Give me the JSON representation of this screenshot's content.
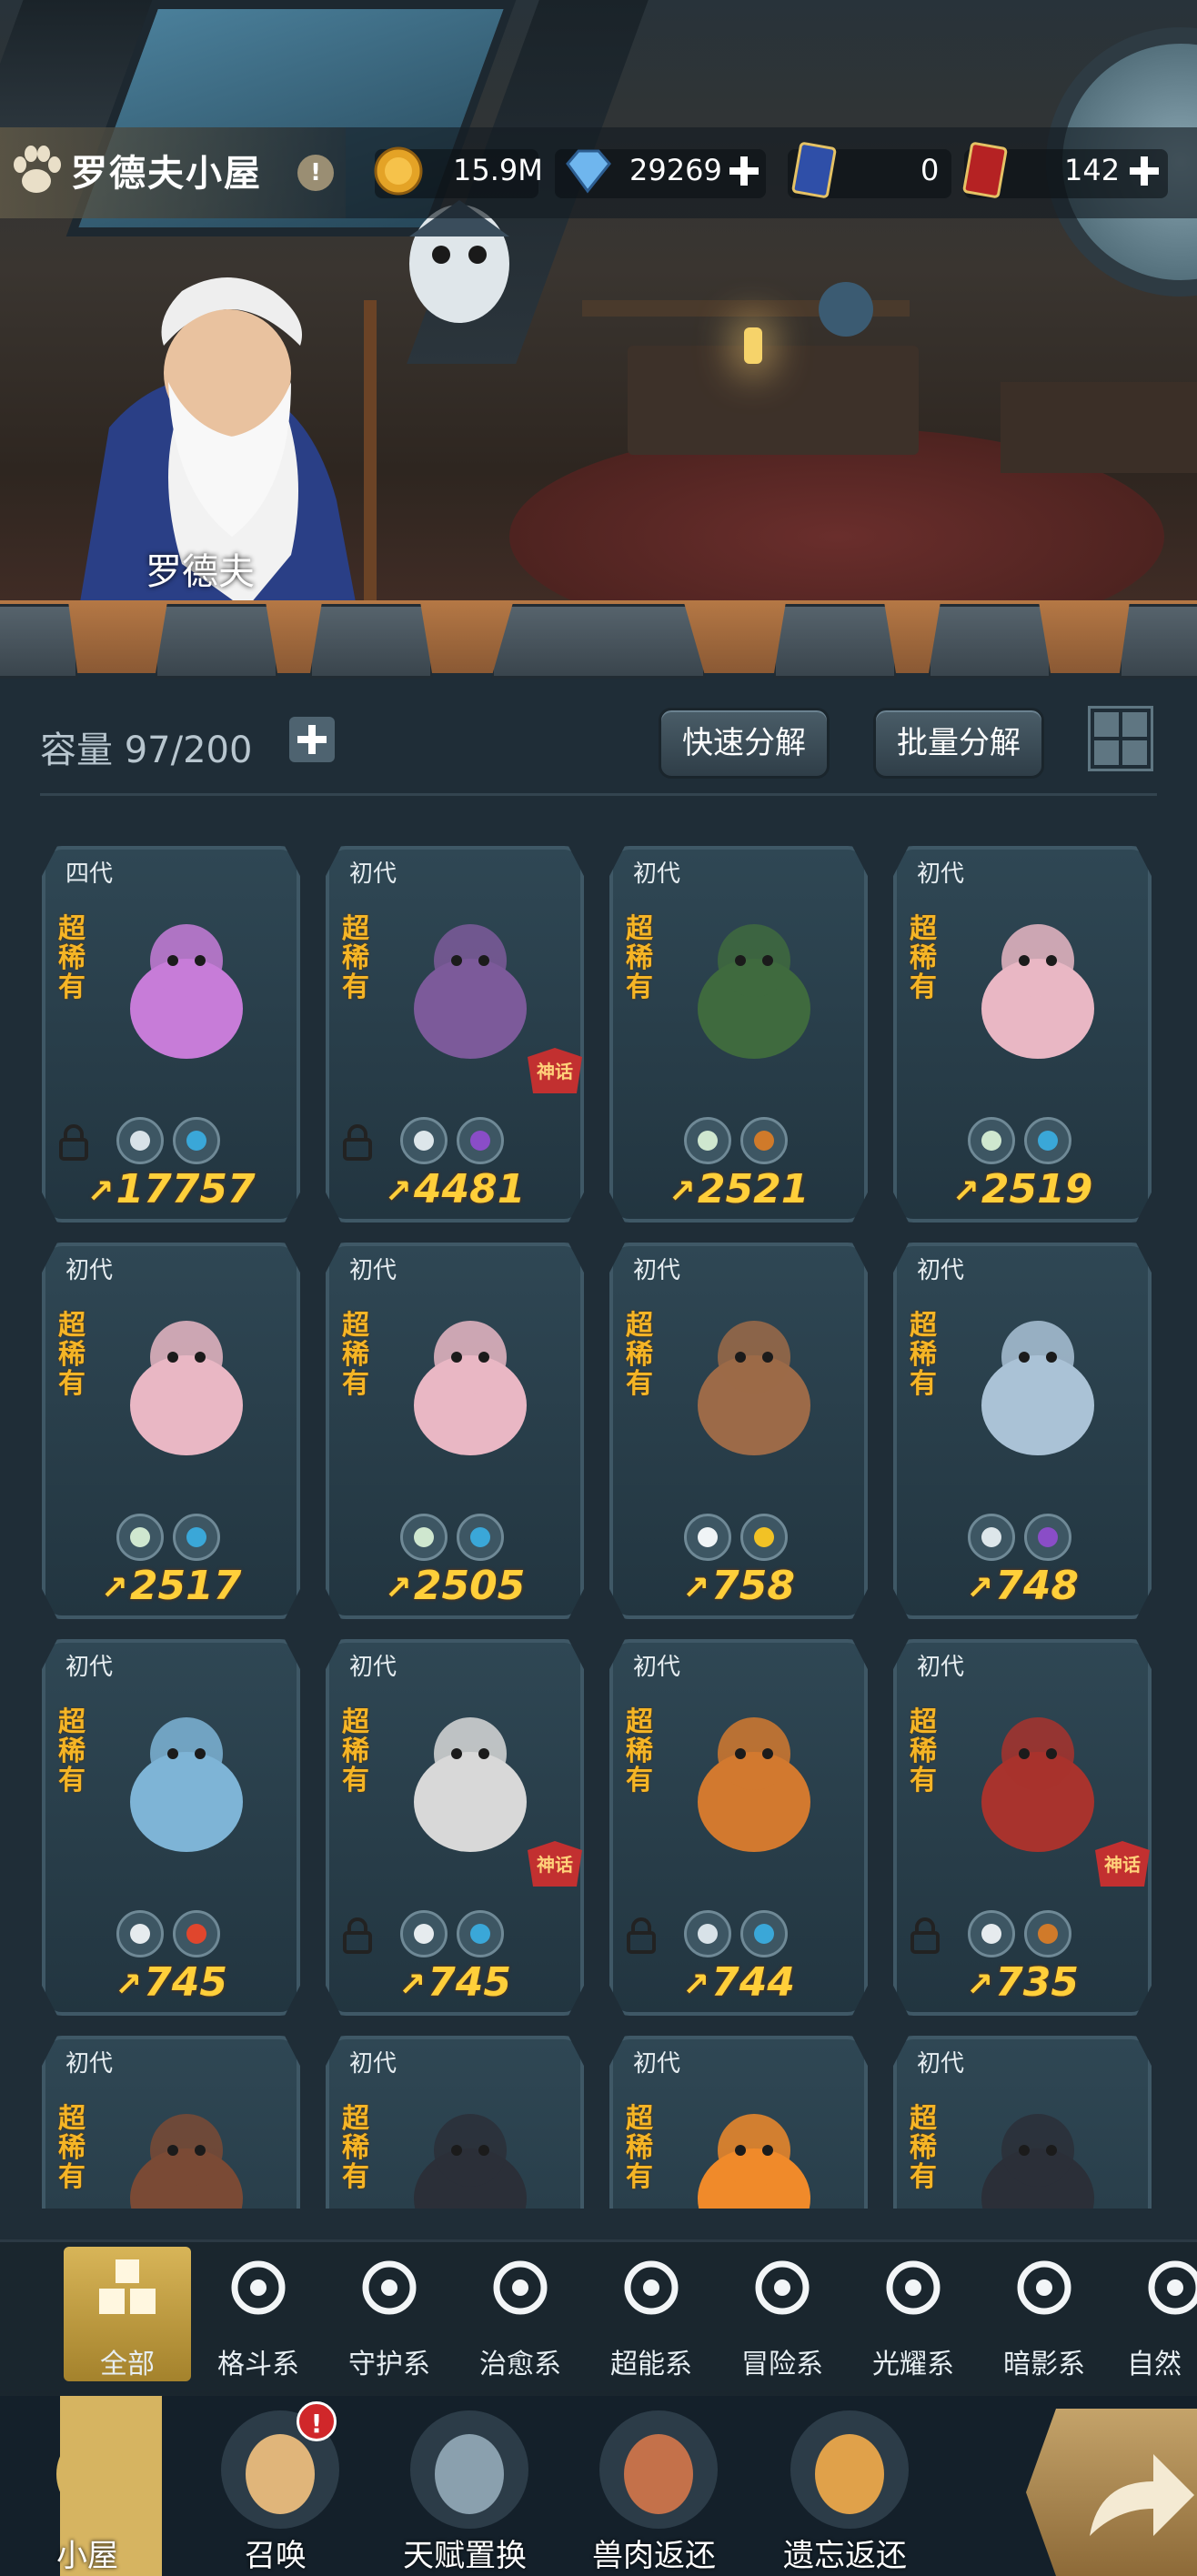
{
  "header": {
    "title": "罗德夫小屋",
    "npc_name": "罗德夫",
    "resources": {
      "gold": "15.9M",
      "diamond": "29269",
      "ticket": "0",
      "card": "142"
    }
  },
  "inventory": {
    "capacity_label": "容量 97/200",
    "quick_decompose": "快速分解",
    "batch_decompose": "批量分解",
    "cards": [
      {
        "gen": "四代",
        "rarity": "超稀有",
        "power": "17757",
        "locked": true,
        "badge": "",
        "color": "#c77cd8",
        "tags": [
          "guard",
          "water"
        ]
      },
      {
        "gen": "初代",
        "rarity": "超稀有",
        "power": "4481",
        "locked": true,
        "badge": "神话",
        "color": "#7c5a9a",
        "tags": [
          "eye",
          "moon"
        ]
      },
      {
        "gen": "初代",
        "rarity": "超稀有",
        "power": "2521",
        "locked": false,
        "badge": "",
        "color": "#3f6a3e",
        "tags": [
          "leaf",
          "earth"
        ]
      },
      {
        "gen": "初代",
        "rarity": "超稀有",
        "power": "2519",
        "locked": false,
        "badge": "",
        "color": "#e9b7c4",
        "tags": [
          "leaf",
          "water"
        ]
      },
      {
        "gen": "初代",
        "rarity": "超稀有",
        "power": "2517",
        "locked": false,
        "badge": "",
        "color": "#e9b7c4",
        "tags": [
          "leaf",
          "water"
        ]
      },
      {
        "gen": "初代",
        "rarity": "超稀有",
        "power": "2505",
        "locked": false,
        "badge": "",
        "color": "#e9b7c4",
        "tags": [
          "leaf",
          "water"
        ]
      },
      {
        "gen": "初代",
        "rarity": "超稀有",
        "power": "758",
        "locked": false,
        "badge": "",
        "color": "#9c6a48",
        "tags": [
          "star4",
          "star6"
        ]
      },
      {
        "gen": "初代",
        "rarity": "超稀有",
        "power": "748",
        "locked": false,
        "badge": "",
        "color": "#aac2d6",
        "tags": [
          "eye",
          "moon"
        ]
      },
      {
        "gen": "初代",
        "rarity": "超稀有",
        "power": "745",
        "locked": false,
        "badge": "",
        "color": "#7eb4d6",
        "tags": [
          "adv",
          "fire"
        ]
      },
      {
        "gen": "初代",
        "rarity": "超稀有",
        "power": "745",
        "locked": true,
        "badge": "神话",
        "color": "#d8d8d8",
        "tags": [
          "adv",
          "water"
        ]
      },
      {
        "gen": "初代",
        "rarity": "超稀有",
        "power": "744",
        "locked": true,
        "badge": "",
        "color": "#d2792f",
        "tags": [
          "guard",
          "water"
        ]
      },
      {
        "gen": "初代",
        "rarity": "超稀有",
        "power": "735",
        "locked": true,
        "badge": "神话",
        "color": "#a8332d",
        "tags": [
          "fist",
          "earth"
        ]
      },
      {
        "gen": "初代",
        "rarity": "超稀有",
        "power": "",
        "locked": false,
        "badge": "",
        "color": "#7a4a35",
        "tags": []
      },
      {
        "gen": "初代",
        "rarity": "超稀有",
        "power": "",
        "locked": false,
        "badge": "",
        "color": "#2b2f38",
        "tags": []
      },
      {
        "gen": "初代",
        "rarity": "超稀有",
        "power": "",
        "locked": false,
        "badge": "",
        "color": "#f08a2a",
        "tags": []
      },
      {
        "gen": "初代",
        "rarity": "超稀有",
        "power": "",
        "locked": false,
        "badge": "",
        "color": "#2b2f38",
        "tags": []
      }
    ]
  },
  "filter_tabs": [
    {
      "label": "全部",
      "icon": "grid-icon"
    },
    {
      "label": "格斗系",
      "icon": "fist-icon"
    },
    {
      "label": "守护系",
      "icon": "shield-icon"
    },
    {
      "label": "治愈系",
      "icon": "sprout-icon"
    },
    {
      "label": "超能系",
      "icon": "alien-icon"
    },
    {
      "label": "冒险系",
      "icon": "hat-icon"
    },
    {
      "label": "光耀系",
      "icon": "star-icon"
    },
    {
      "label": "暗影系",
      "icon": "eye-icon"
    },
    {
      "label": "自然",
      "icon": "leaf-icon"
    }
  ],
  "bottom_nav": [
    {
      "label": "小屋",
      "icon": "house-icon"
    },
    {
      "label": "召唤",
      "icon": "egg-icon",
      "alert": "!"
    },
    {
      "label": "天赋置换",
      "icon": "swap-icon"
    },
    {
      "label": "兽肉返还",
      "icon": "meat-icon"
    },
    {
      "label": "遗忘返还",
      "icon": "flame-icon"
    }
  ],
  "colors": {
    "accent": "#d6b461",
    "power": "#ffcf3a",
    "rarity": "#f5b526",
    "panel": "#223540"
  }
}
